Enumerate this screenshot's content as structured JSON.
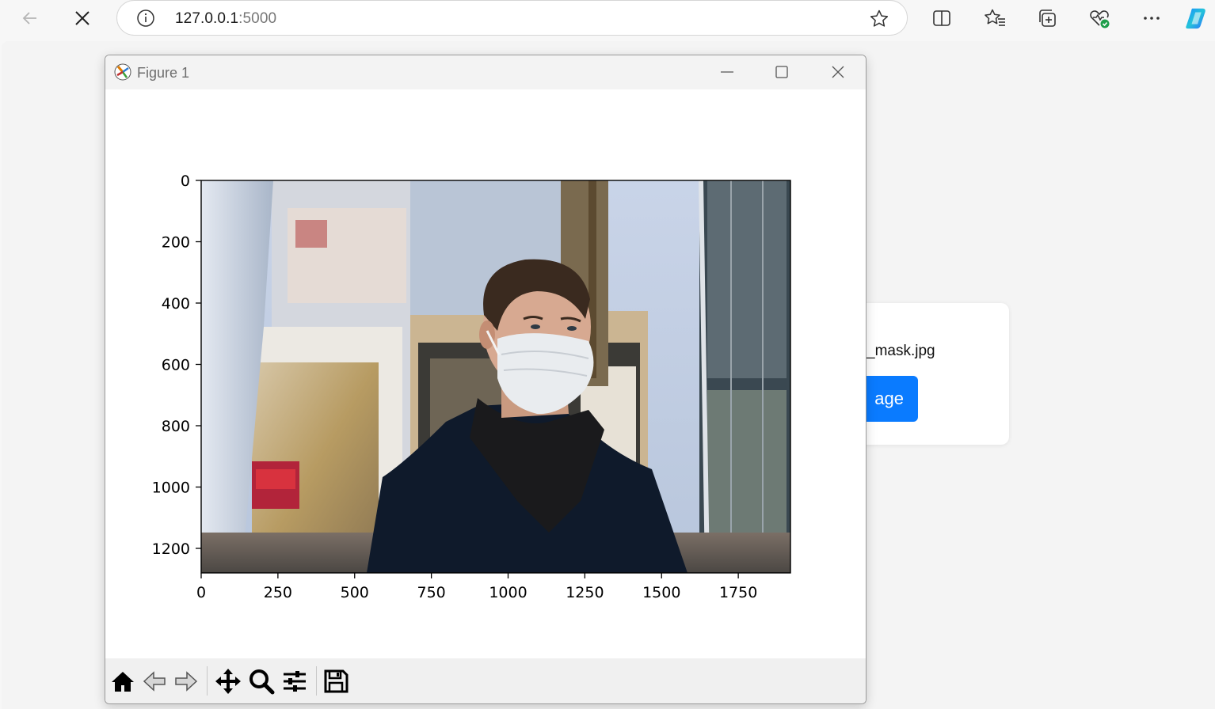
{
  "browser": {
    "url_host": "127.0.0.1",
    "url_port": ":5000",
    "icons": [
      "back-arrow-icon",
      "close-icon",
      "info-icon",
      "star-icon",
      "split-screen-icon",
      "favorites-icon",
      "collections-icon",
      "browser-essentials-icon",
      "more-icon",
      "copilot-icon"
    ]
  },
  "page": {
    "file_name": "_mask.jpg",
    "button_label": "age"
  },
  "figure": {
    "window_title": "Figure 1",
    "window_controls": [
      "minimize-icon",
      "maximize-icon",
      "close-icon"
    ],
    "toolbar_icons": [
      "home-icon",
      "back-icon",
      "forward-icon",
      "pan-icon",
      "zoom-icon",
      "configure-subplots-icon",
      "save-icon"
    ],
    "image_description": "photograph",
    "colors": {
      "accent": "#0a7bff"
    }
  },
  "chart_data": {
    "type": "image",
    "xlabel": "",
    "ylabel": "",
    "xlim": [
      0,
      1920
    ],
    "ylim": [
      1280,
      0
    ],
    "xticks": [
      0,
      250,
      500,
      750,
      1000,
      1250,
      1500,
      1750
    ],
    "yticks": [
      0,
      200,
      400,
      600,
      800,
      1000,
      1200
    ],
    "xtick_labels": [
      "0",
      "250",
      "500",
      "750",
      "1000",
      "1250",
      "1500",
      "1750"
    ],
    "ytick_labels": [
      "0",
      "200",
      "400",
      "600",
      "800",
      "1000",
      "1200"
    ]
  }
}
